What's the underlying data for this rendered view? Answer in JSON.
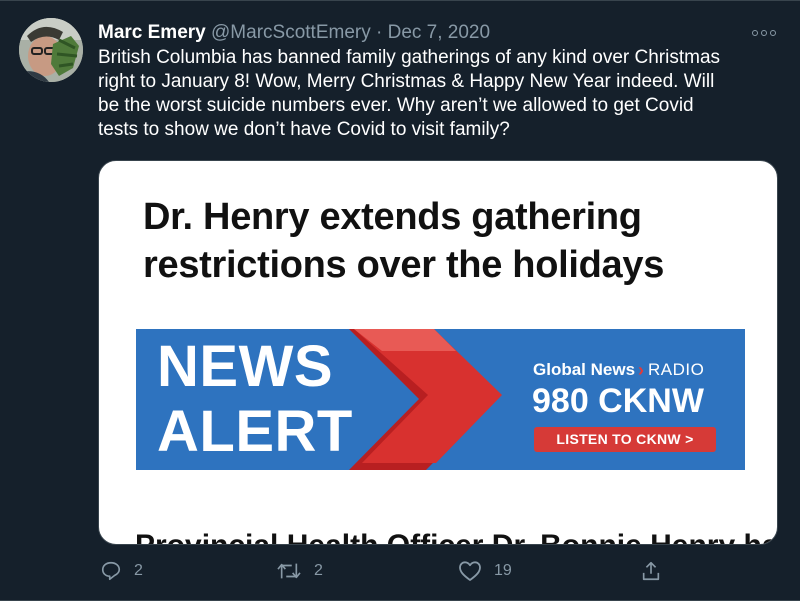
{
  "tweet": {
    "author_name": "Marc Emery",
    "handle": "@MarcScottEmery",
    "separator": "·",
    "date": "Dec 7, 2020",
    "text_lines": [
      "British Columbia has banned family gatherings of any kind over Christmas",
      "right to January 8! Wow, Merry Christmas & Happy New Year indeed. Will",
      "be the worst suicide numbers ever. Why aren’t we allowed to get Covid",
      "tests to show we don’t have Covid to visit family?"
    ]
  },
  "card": {
    "headline_lines": [
      "Dr. Henry extends gathering",
      "restrictions over the holidays"
    ],
    "banner": {
      "news": "NEWS",
      "alert": "ALERT",
      "brand": "Global News",
      "chevron": "›",
      "radio": "RADIO",
      "station": "980 CKNW",
      "listen": "LISTEN TO CKNW >",
      "colors": {
        "background": "#2e73bf",
        "chevron": "#d8312f",
        "button": "#d63a37"
      }
    },
    "cut_text": "Provincial Health Officer Dr. Bonnie Henry has"
  },
  "actions": {
    "reply_count": "2",
    "retweet_count": "2",
    "like_count": "19"
  },
  "icons": [
    "more-icon",
    "reply-icon",
    "retweet-icon",
    "like-icon",
    "share-icon"
  ],
  "theme": {
    "background": "#15202b",
    "muted": "#8899a6",
    "text": "#ffffff"
  }
}
